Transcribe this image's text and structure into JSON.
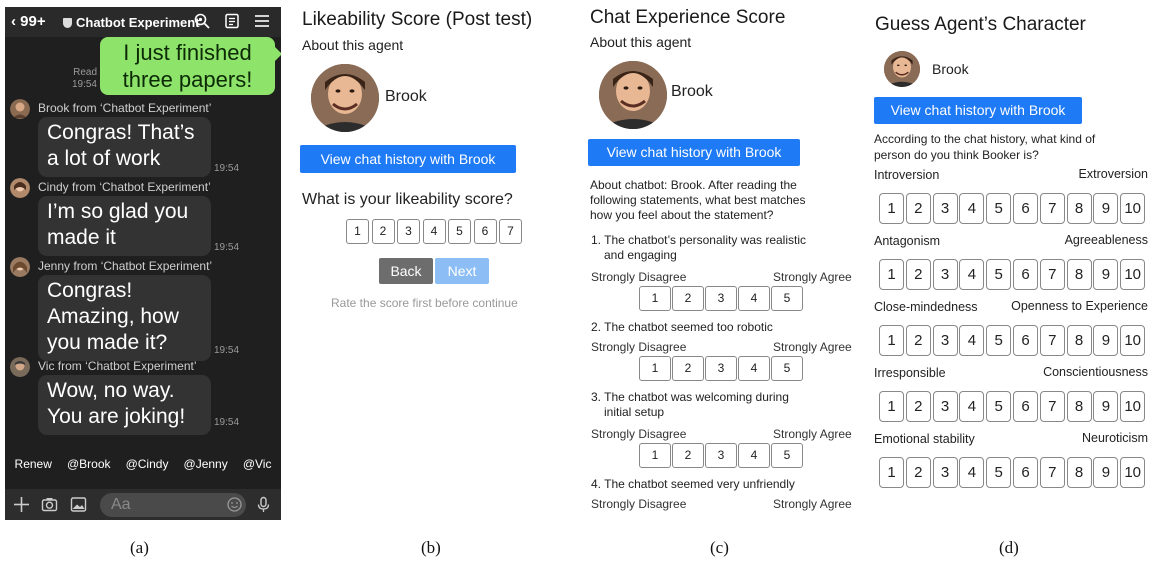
{
  "panel_a": {
    "back_count": "99+",
    "title": "Chatbot Experiment",
    "my_message_line1": "I just finished",
    "my_message_line2": "three papers!",
    "read_label": "Read",
    "read_time": "19:54",
    "messages": [
      {
        "from": "Brook from ‘Chatbot Experiment’",
        "line1": "Congras! That’s",
        "line2": "a lot of work",
        "line3": "",
        "time": "19:54"
      },
      {
        "from": "Cindy from ‘Chatbot Experiment’",
        "line1": "I’m so glad you",
        "line2": "made it",
        "line3": "",
        "time": "19:54"
      },
      {
        "from": "Jenny from ‘Chatbot Experiment’",
        "line1": "Congras!",
        "line2": "Amazing, how",
        "line3": "you made it?",
        "time": "19:54"
      },
      {
        "from": "Vic from ‘Chatbot Experiment’",
        "line1": "Wow, no way.",
        "line2": "You are joking!",
        "line3": "",
        "time": "19:54"
      }
    ],
    "mentions": [
      "Renew",
      "@Brook",
      "@Cindy",
      "@Jenny",
      "@Vic"
    ],
    "input_placeholder": "Aa",
    "caption": "(a)"
  },
  "panel_b": {
    "title": "Likeability Score (Post test)",
    "about": "About this agent",
    "agent_name": "Brook",
    "history_button": "View chat history with Brook",
    "question": "What is your likeability score?",
    "scale": [
      "1",
      "2",
      "3",
      "4",
      "5",
      "6",
      "7"
    ],
    "back_button": "Back",
    "next_button": "Next",
    "hint": "Rate the score first before continue",
    "caption": "(b)"
  },
  "panel_c": {
    "title": "Chat Experience Score",
    "about": "About this agent",
    "agent_name": "Brook",
    "history_button": "View chat history with Brook",
    "intro_line1": "About chatbot: Brook. After reading the",
    "intro_line2": "following statements, what best matches",
    "intro_line3": "how you feel about the statement?",
    "statements": [
      {
        "line1": "1. The chatbot’s personality was realistic",
        "line2": "and engaging"
      },
      {
        "line1": "2. The chatbot seemed too robotic",
        "line2": ""
      },
      {
        "line1": "3. The chatbot was welcoming during",
        "line2": "initial setup"
      },
      {
        "line1": "4. The chatbot seemed very unfriendly",
        "line2": ""
      }
    ],
    "left_anchor": "Strongly Disagree",
    "right_anchor": "Strongly Agree",
    "scale": [
      "1",
      "2",
      "3",
      "4",
      "5"
    ],
    "caption": "(c)"
  },
  "panel_d": {
    "title": "Guess Agent’s Character",
    "agent_name": "Brook",
    "history_button": "View chat history with Brook",
    "question_line1": "According to the chat history, what kind of",
    "question_line2": "person do you think Booker is?",
    "traits": [
      {
        "left": "Introversion",
        "right": "Extroversion"
      },
      {
        "left": "Antagonism",
        "right": "Agreeableness"
      },
      {
        "left": "Close-mindedness",
        "right": "Openness to Experience"
      },
      {
        "left": "Irresponsible",
        "right": "Conscientiousness"
      },
      {
        "left": "Emotional stability",
        "right": "Neuroticism"
      }
    ],
    "scale": [
      "1",
      "2",
      "3",
      "4",
      "5",
      "6",
      "7",
      "8",
      "9",
      "10"
    ],
    "caption": "(d)"
  },
  "colors": {
    "primary_button": "#1f7af5",
    "next_button": "#8cbef5",
    "back_button": "#6d6d6d",
    "my_bubble": "#8ee36b"
  }
}
